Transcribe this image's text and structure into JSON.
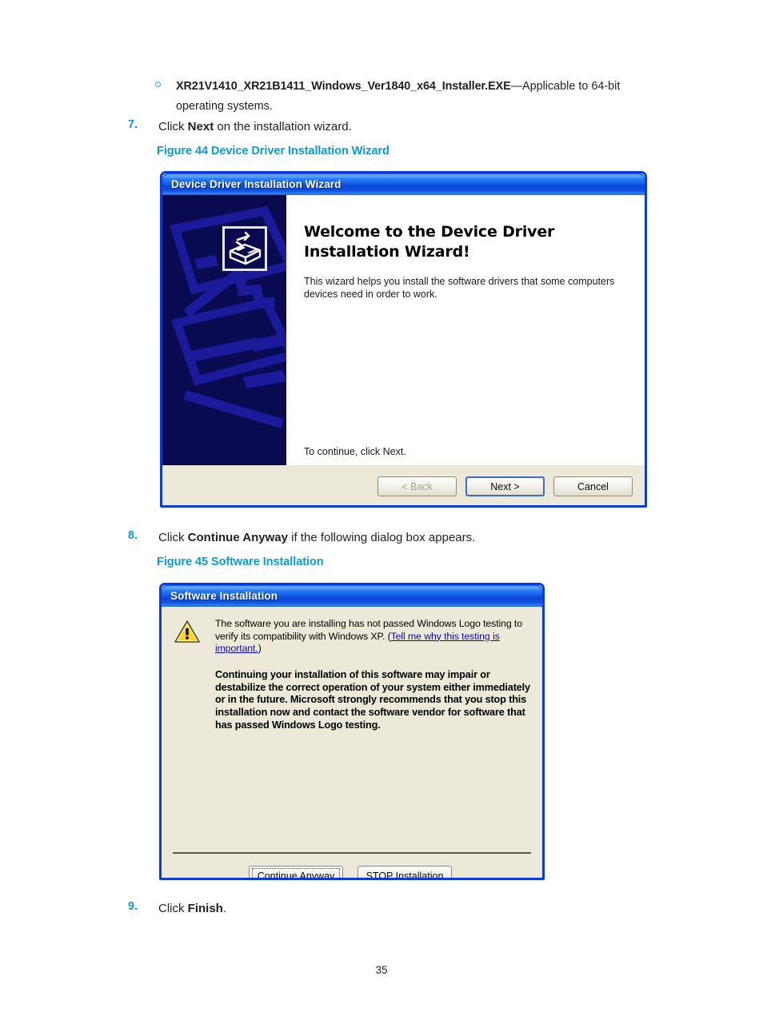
{
  "document": {
    "page_number": "35",
    "bullet": {
      "marker": "circle-bullet",
      "bold_text": "XR21V1410_XR21B1411_Windows_Ver1840_x64_Installer.EXE",
      "rest_text": "—Applicable to 64-bit operating systems."
    },
    "steps": [
      {
        "number": "7.",
        "prefix": "Click ",
        "bold": "Next",
        "suffix": " on the installation wizard."
      },
      {
        "number": "8.",
        "prefix": "Click ",
        "bold": "Continue Anyway",
        "suffix": " if the following dialog box appears."
      },
      {
        "number": "9.",
        "prefix": "Click ",
        "bold": "Finish",
        "suffix": "."
      }
    ],
    "figures": [
      {
        "caption": "Figure 44 Device Driver Installation Wizard"
      },
      {
        "caption": "Figure 45 Software Installation"
      }
    ],
    "accent_color": "#0a9bd5"
  },
  "wizard_dialog": {
    "title": "Device Driver Installation Wizard",
    "heading_line1": "Welcome to the Device Driver",
    "heading_line2": "Installation Wizard!",
    "description": "This wizard helps you install the software drivers that some computers devices need in order to work.",
    "continue_hint": "To continue, click Next.",
    "sidebar_icon": "device-driver-icon",
    "sidebar_bg": "#0a0a50",
    "sidebar_art": "#1a1a9a",
    "buttons": [
      {
        "label": "< Back",
        "state": "disabled"
      },
      {
        "label": "Next >",
        "state": "default"
      },
      {
        "label": "Cancel",
        "state": "normal"
      }
    ]
  },
  "software_dialog": {
    "title": "Software Installation",
    "icon": "warning-triangle-icon",
    "paragraph1_a": "The software you are installing has not passed Windows Logo testing to verify its compatibility with Windows XP. (",
    "paragraph1_link": "Tell me why this testing is important.",
    "paragraph1_b": ")",
    "paragraph2": "Continuing your installation of this software may impair or destabilize the correct operation of your system either immediately or in the future. Microsoft strongly recommends that you stop this installation now and contact the software vendor for software that has passed Windows Logo testing.",
    "buttons": [
      {
        "label": "Continue Anyway",
        "state": "focused"
      },
      {
        "label": "STOP Installation",
        "state": "normal"
      }
    ]
  }
}
